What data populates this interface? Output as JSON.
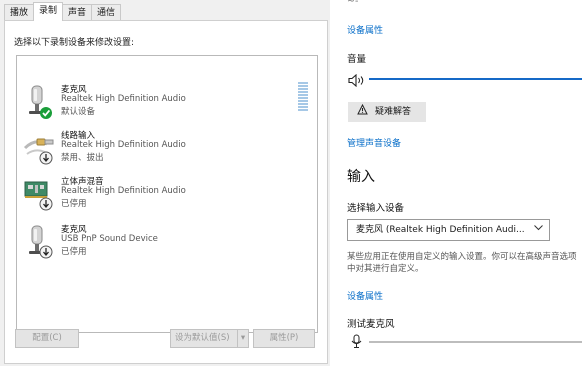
{
  "sound_dialog": {
    "tabs": [
      "播放",
      "录制",
      "声音",
      "通信"
    ],
    "active_tab": 1,
    "instruction": "选择以下录制设备来修改设置:",
    "devices": [
      {
        "name": "麦克风",
        "description": "Realtek High Definition Audio",
        "status": "默认设备",
        "badge": "default-check",
        "icon": "microphone-icon"
      },
      {
        "name": "线路输入",
        "description": "Realtek High Definition Audio",
        "status": "禁用、拔出",
        "badge": "down-arrow",
        "icon": "line-in-cable-icon"
      },
      {
        "name": "立体声混音",
        "description": "Realtek High Definition Audio",
        "status": "已停用",
        "badge": "down-arrow",
        "icon": "sound-card-icon"
      },
      {
        "name": "麦克风",
        "description": "USB PnP Sound Device",
        "status": "已停用",
        "badge": "down-arrow",
        "icon": "microphone-icon"
      }
    ],
    "buttons": {
      "configure": "配置(C)",
      "set_default": "设为默认值(S)",
      "properties": "属性(P)"
    }
  },
  "settings": {
    "top_fragment": "~-",
    "device_properties_link": "设备属性",
    "volume_label": "音量",
    "volume_value": 100,
    "troubleshoot_button": "疑难解答",
    "manage_devices_link": "管理声音设备",
    "input_heading": "输入",
    "choose_input_label": "选择输入设备",
    "input_device_selected": "麦克风 (Realtek High Definition Audi...",
    "info_text": "某些应用正在使用自定义的输入设置。你可以在高级声音选项中对其进行自定义。",
    "input_device_properties_link": "设备属性",
    "test_mic_label": "测试麦克风",
    "mic_level": 0
  }
}
